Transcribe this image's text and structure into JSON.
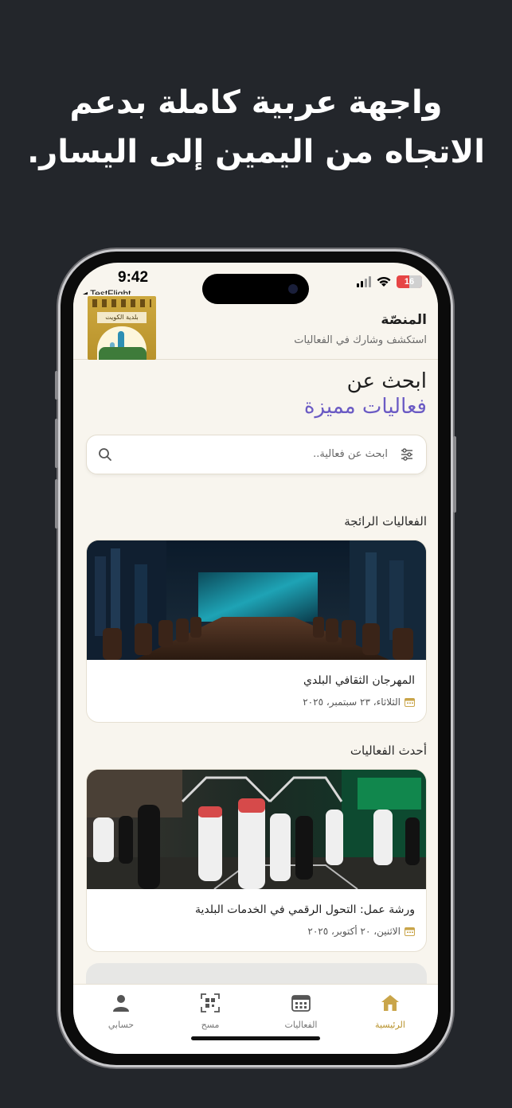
{
  "promo": {
    "line1": "واجهة عربية كاملة بدعم",
    "line2": "الاتجاه من اليمين إلى اليسار."
  },
  "status_bar": {
    "time": "9:42",
    "back_app": "◂ TestFlight",
    "battery": "16"
  },
  "header": {
    "title": "المنصّة",
    "subtitle": "استكشف وشارك في الفعاليات",
    "logo_text": "بلدية الكويت"
  },
  "hero": {
    "line1": "ابحث عن",
    "line2": "فعاليات مميزة"
  },
  "search": {
    "placeholder": "ابحث عن فعالية.."
  },
  "sections": {
    "trending": "الفعاليات الرائجة",
    "latest": "أحدث الفعاليات"
  },
  "events": [
    {
      "title": "المهرجان الثقافي البلدي",
      "date": "الثلاثاء، ٢٣ سبتمبر، ٢٠٢٥"
    },
    {
      "title": "ورشة عمل: التحول الرقمي في الخدمات البلدية",
      "date": "الاثنين، ٢٠ أكتوبر، ٢٠٢٥"
    }
  ],
  "tabbar": {
    "home": "الرئيسية",
    "events": "الفعاليات",
    "scan": "مسح",
    "account": "حسابي"
  },
  "colors": {
    "accent_gold": "#b8922b",
    "accent_purple": "#6b5bc4",
    "background": "#f8f5ee"
  }
}
